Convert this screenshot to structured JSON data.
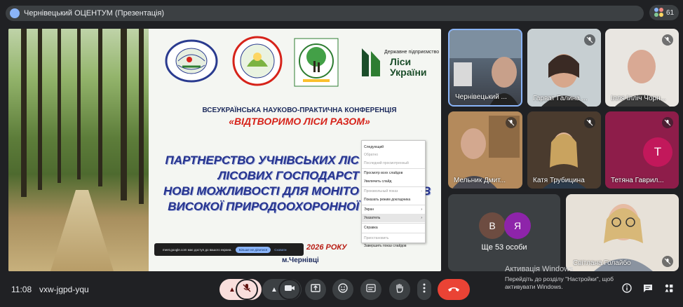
{
  "meeting": {
    "title": "Чернівецький ОЦЕНТУМ (Презентація)",
    "participant_count": "61",
    "time": "11:08",
    "code": "vxw-jgpd-yqu"
  },
  "slide": {
    "logo_lisy_small": "Державне підприємство",
    "logo_lisy_big": "Ліси України",
    "conference_line": "ВСЕУКРАЇНСЬКА НАУКОВО-ПРАКТИЧНА КОНФЕРЕНЦІЯ",
    "conference_title": "«ВІДТВОРИМО ЛІСИ РАЗОМ»",
    "headline_1": "ПАРТНЕРСТВО УЧНІВСЬКИХ ЛІС",
    "headline_2": "ЛІСОВИХ ГОСПОДАРСТ",
    "headline_3": "НОВІ МОЖЛИВОСТІ ДЛЯ МОНІТО",
    "headline_3_end": "В",
    "headline_4": "ВИСОКОЇ ПРИРОДООХОРОННОЇ",
    "year": "2026 РОКУ",
    "city": "м.Чернівці"
  },
  "share_banner": {
    "text": "meet.google.com має доступ до вашого екрана.",
    "stop_label": "Більше не ділитися",
    "hide_label": "Сховати"
  },
  "context_menu": {
    "items": [
      {
        "label": "Следующий",
        "disabled": false,
        "arrow": false
      },
      {
        "label": "Обратно",
        "disabled": true,
        "arrow": false
      },
      {
        "label": "Последний просмотренный",
        "disabled": true,
        "arrow": false
      },
      {
        "label": "Просмотр всех слайдов",
        "disabled": false,
        "arrow": false
      },
      {
        "label": "Увеличить слайд",
        "disabled": false,
        "arrow": false
      },
      {
        "label": "Произвольный показ",
        "disabled": true,
        "arrow": true
      },
      {
        "label": "Показать режим докладчика",
        "disabled": false,
        "arrow": false
      },
      {
        "label": "Экран",
        "disabled": false,
        "arrow": true
      },
      {
        "label": "Указатель",
        "disabled": false,
        "arrow": true
      },
      {
        "label": "Справка",
        "disabled": false,
        "arrow": false
      },
      {
        "label": "Приостановить",
        "disabled": true,
        "arrow": false
      },
      {
        "label": "Завершить показ слайдов",
        "disabled": false,
        "arrow": false
      }
    ]
  },
  "participants": {
    "p1": "Чернівецький ...",
    "p2": "Гарват Галина ...",
    "p3": "Ілля Ілліч Чорн...",
    "p4": "Мельник Дмит...",
    "p5": "Катя Трубицина",
    "p6": "Тетяна Гаврил...",
    "p6_initial": "T",
    "more_avatar_1": "B",
    "more_avatar_2": "Я",
    "more_label": "Ще 53 особи",
    "p7": "Світлана Голайбо"
  },
  "watermark": {
    "title": "Активація Windows",
    "subtitle": "Перейдіть до розділу \"Настройки\", щоб активувати Windows."
  },
  "colors": {
    "end_call": "#ea4335",
    "mic_muted_bg": "#f9dedc",
    "avatar_T": "#c2185b",
    "avatar_B": "#6d4c41",
    "avatar_Ya": "#8e24aa"
  },
  "icons": [
    "meet-icon",
    "people-icon",
    "mic-off-icon",
    "camera-icon",
    "present-icon",
    "emoji-icon",
    "captions-icon",
    "hand-icon",
    "more-icon",
    "end-call-icon",
    "info-icon",
    "chat-icon",
    "activities-icon",
    "chevron-up-icon"
  ]
}
